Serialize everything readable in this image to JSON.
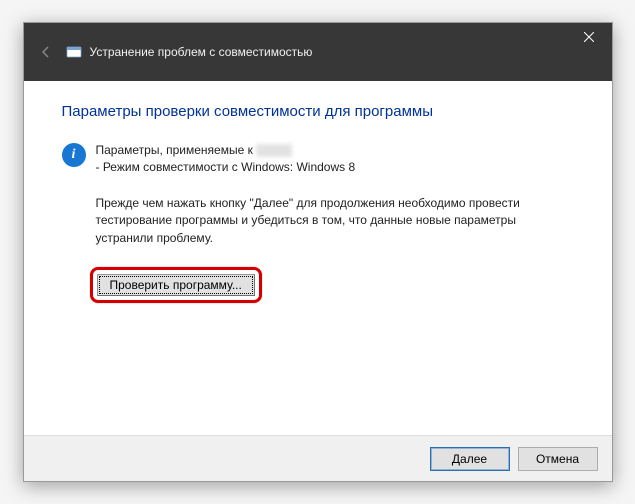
{
  "titlebar": {
    "title": "Устранение проблем с совместимостью"
  },
  "content": {
    "heading": "Параметры проверки совместимости для программы",
    "info_line1_prefix": "Параметры, применяемые к",
    "info_line2": "- Режим совместимости с Windows: Windows 8",
    "instruction": "Прежде чем нажать кнопку \"Далее\" для продолжения необходимо провести тестирование программы и убедиться в том, что данные новые параметры устранили проблему.",
    "test_button": "Проверить программу..."
  },
  "footer": {
    "next": "Далее",
    "cancel": "Отмена"
  }
}
